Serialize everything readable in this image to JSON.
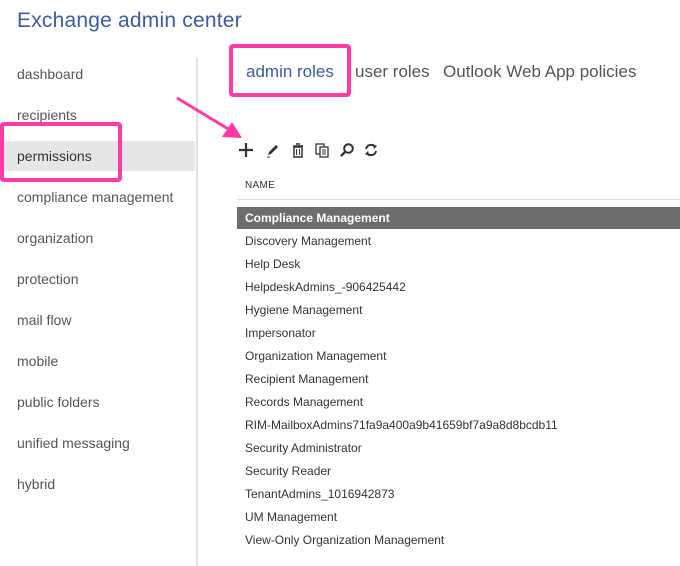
{
  "app": {
    "title": "Exchange admin center"
  },
  "sidebar": {
    "items": [
      {
        "label": "dashboard"
      },
      {
        "label": "recipients"
      },
      {
        "label": "permissions",
        "selected": true
      },
      {
        "label": "compliance management"
      },
      {
        "label": "organization"
      },
      {
        "label": "protection"
      },
      {
        "label": "mail flow"
      },
      {
        "label": "mobile"
      },
      {
        "label": "public folders"
      },
      {
        "label": "unified messaging"
      },
      {
        "label": "hybrid"
      }
    ]
  },
  "tabs": [
    {
      "label": "admin roles",
      "selected": true
    },
    {
      "label": "user roles"
    },
    {
      "label": "Outlook Web App policies"
    }
  ],
  "toolbar": {
    "icons": [
      "add-icon",
      "edit-icon",
      "delete-icon",
      "copy-icon",
      "search-icon",
      "refresh-icon"
    ]
  },
  "table": {
    "column_header": "NAME",
    "rows": [
      "Compliance Management",
      "Discovery Management",
      "Help Desk",
      "HelpdeskAdmins_-906425442",
      "Hygiene Management",
      "Impersonator",
      "Organization Management",
      "Recipient Management",
      "Records Management",
      "RIM-MailboxAdmins71fa9a400a9b41659bf7a9a8d8bcdb11",
      "Security Administrator",
      "Security Reader",
      "TenantAdmins_1016942873",
      "UM Management",
      "View-Only Organization Management"
    ],
    "selected_row": "Compliance Management"
  },
  "colors": {
    "accent": "#3c5aa6",
    "highlight": "#ff3aa6",
    "selected_row_bg": "#6d6d6d",
    "selected_nav_bg": "#e6e6e6"
  }
}
